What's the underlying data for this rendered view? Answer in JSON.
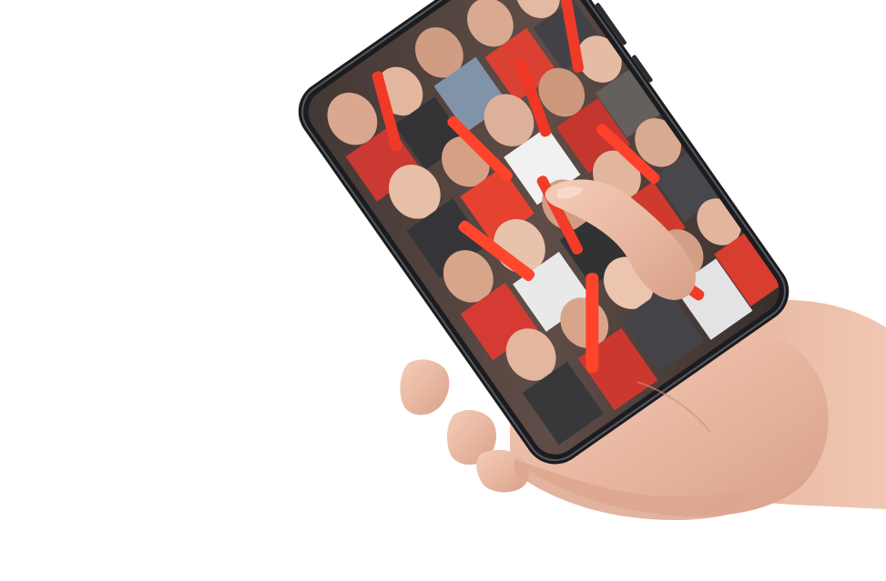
{
  "scene": {
    "background_color": "#ffffff",
    "subject": "hand-holding-smartphone",
    "phone": {
      "frame_color": "#1b1c1f",
      "screen_content": "photo-of-cheering-sports-crowd",
      "accent_color": "#e8301c"
    },
    "hand": {
      "skin_color": "#e9b8a2",
      "shadow_color": "#c9907a"
    }
  }
}
